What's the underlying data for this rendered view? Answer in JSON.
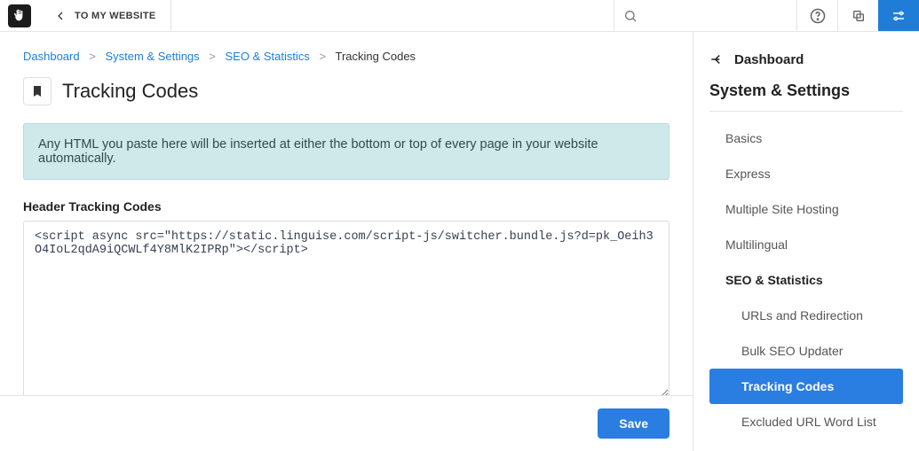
{
  "topbar": {
    "to_my_website_label": "TO MY WEBSITE"
  },
  "breadcrumb": {
    "items": [
      "Dashboard",
      "System & Settings",
      "SEO & Statistics"
    ],
    "current": "Tracking Codes",
    "sep": ">"
  },
  "page": {
    "title": "Tracking Codes",
    "alert": "Any HTML you paste here will be inserted at either the bottom or top of every page in your website automatically.",
    "header_codes_label": "Header Tracking Codes",
    "header_codes_value": "<script async src=\"https://static.linguise.com/script-js/switcher.bundle.js?d=pk_Oeih3O4IoL2qdA9iQCWLf4Y8MlK2IPRp\"></script>",
    "save_label": "Save"
  },
  "sidebar": {
    "back_label": "Dashboard",
    "title": "System & Settings",
    "links": {
      "basics": "Basics",
      "express": "Express",
      "multiple_site_hosting": "Multiple Site Hosting",
      "multilingual": "Multilingual",
      "seo_stats": "SEO & Statistics",
      "urls_redirection": "URLs and Redirection",
      "bulk_seo": "Bulk SEO Updater",
      "tracking_codes": "Tracking Codes",
      "excluded_url": "Excluded URL Word List"
    }
  }
}
